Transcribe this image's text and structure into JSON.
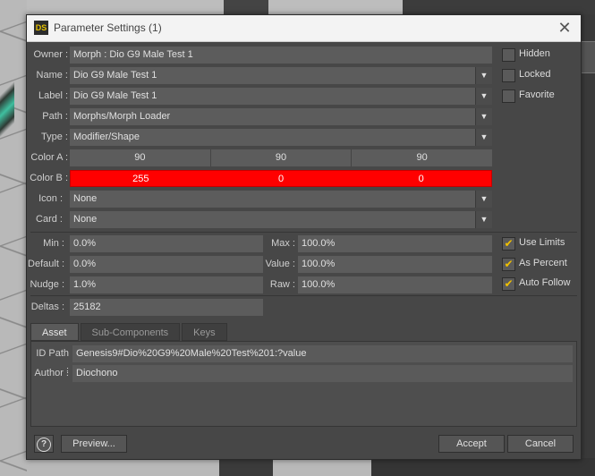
{
  "window": {
    "title": "Parameter Settings (1)",
    "app_icon_text": "DS"
  },
  "fields": {
    "owner": {
      "label": "Owner :",
      "value": "Morph : Dio G9 Male Test 1"
    },
    "name": {
      "label": "Name :",
      "value": "Dio G9 Male Test 1"
    },
    "label": {
      "label": "Label :",
      "value": "Dio G9 Male Test 1"
    },
    "path": {
      "label": "Path :",
      "value": "Morphs/Morph Loader"
    },
    "type": {
      "label": "Type :",
      "value": "Modifier/Shape"
    },
    "color_a": {
      "label": "Color A :",
      "values": [
        "90",
        "90",
        "90"
      ],
      "color": "#5c5c5c"
    },
    "color_b": {
      "label": "Color B :",
      "values": [
        "255",
        "0",
        "0"
      ],
      "color": "#ff0000"
    },
    "icon": {
      "label": "Icon :",
      "value": "None"
    },
    "card": {
      "label": "Card :",
      "value": "None"
    }
  },
  "flags": {
    "hidden": {
      "label": "Hidden",
      "checked": false
    },
    "locked": {
      "label": "Locked",
      "checked": false
    },
    "favorite": {
      "label": "Favorite",
      "checked": false
    }
  },
  "limits": {
    "min": {
      "label": "Min :",
      "value": "0.0%"
    },
    "max": {
      "label": "Max :",
      "value": "100.0%"
    },
    "default": {
      "label": "Default :",
      "value": "0.0%"
    },
    "value": {
      "label": "Value :",
      "value": "100.0%"
    },
    "nudge": {
      "label": "Nudge :",
      "value": "1.0%"
    },
    "raw": {
      "label": "Raw :",
      "value": "100.0%"
    },
    "use_limits": {
      "label": "Use Limits",
      "checked": true
    },
    "as_percent": {
      "label": "As Percent",
      "checked": true
    },
    "auto_follow": {
      "label": "Auto Follow",
      "checked": true
    }
  },
  "deltas": {
    "label": "Deltas :",
    "value": "25182"
  },
  "tabs": [
    {
      "label": "Asset",
      "active": true
    },
    {
      "label": "Sub-Components",
      "active": false
    },
    {
      "label": "Keys",
      "active": false
    }
  ],
  "asset": {
    "id_path": {
      "label": "ID Path :",
      "value": "Genesis9#Dio%20G9%20Male%20Test%201:?value"
    },
    "author": {
      "label": "Author :",
      "value": "Diochono"
    }
  },
  "buttons": {
    "help": "?",
    "preview": "Preview...",
    "accept": "Accept",
    "cancel": "Cancel"
  },
  "icons": {
    "dropdown": "chevron-down-icon",
    "check": "checkmark-icon",
    "close": "close-icon",
    "help": "help-icon"
  },
  "colors": {
    "checkmark": "#f0c000",
    "dialog_bg": "#474747"
  }
}
